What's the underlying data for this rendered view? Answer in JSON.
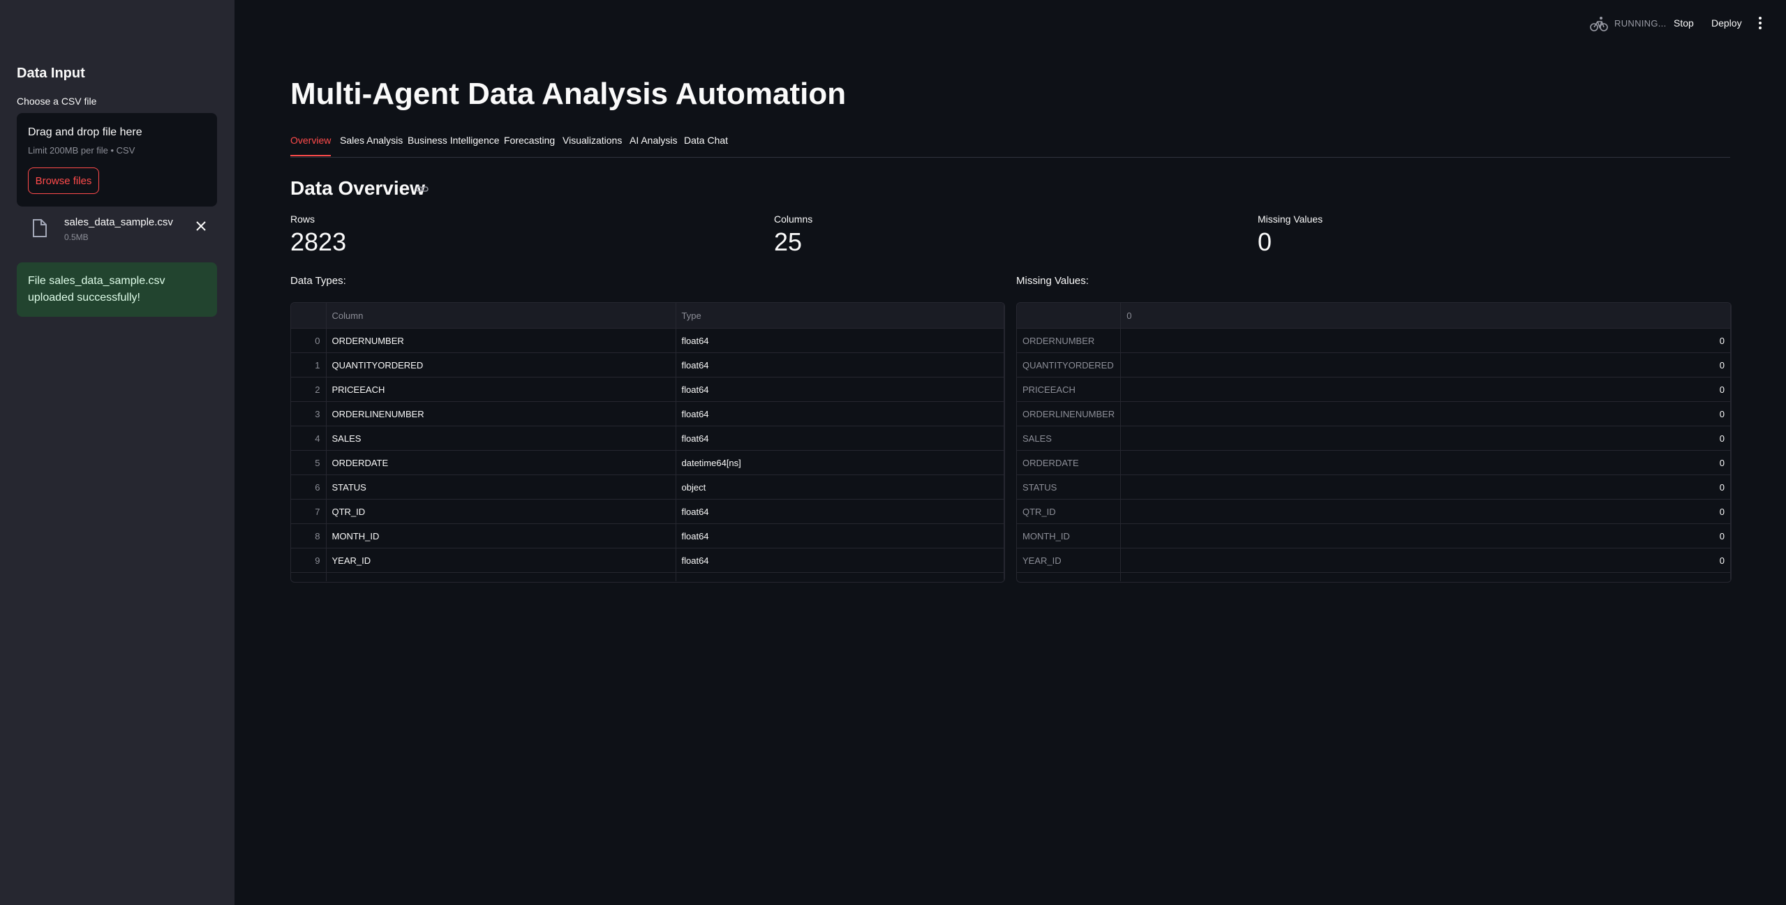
{
  "sidebar": {
    "title": "Data Input",
    "uploader_label": "Choose a CSV file",
    "dropzone_title": "Drag and drop file here",
    "dropzone_limit": "Limit 200MB per file • CSV",
    "browse_label": "Browse files",
    "file": {
      "name": "sales_data_sample.csv",
      "size": "0.5MB"
    },
    "success_message": "File sales_data_sample.csv uploaded successfully!"
  },
  "header": {
    "status": "RUNNING...",
    "stop_label": "Stop",
    "deploy_label": "Deploy"
  },
  "main": {
    "title": "Multi-Agent Data Analysis Automation",
    "tabs": [
      {
        "label": "Overview",
        "active": true
      },
      {
        "label": "Sales Analysis"
      },
      {
        "label": "Business Intelligence"
      },
      {
        "label": "Forecasting"
      },
      {
        "label": "Visualizations"
      },
      {
        "label": "AI Analysis"
      },
      {
        "label": "Data Chat"
      }
    ],
    "section_title": "Data Overview",
    "metrics": {
      "rows": {
        "label": "Rows",
        "value": "2823"
      },
      "columns": {
        "label": "Columns",
        "value": "25"
      },
      "missing": {
        "label": "Missing Values",
        "value": "0"
      }
    },
    "data_types_label": "Data Types:",
    "missing_values_label": "Missing Values:",
    "dtypes_table": {
      "headers": [
        "",
        "Column",
        "Type"
      ],
      "rows": [
        [
          "0",
          "ORDERNUMBER",
          "float64"
        ],
        [
          "1",
          "QUANTITYORDERED",
          "float64"
        ],
        [
          "2",
          "PRICEEACH",
          "float64"
        ],
        [
          "3",
          "ORDERLINENUMBER",
          "float64"
        ],
        [
          "4",
          "SALES",
          "float64"
        ],
        [
          "5",
          "ORDERDATE",
          "datetime64[ns]"
        ],
        [
          "6",
          "STATUS",
          "object"
        ],
        [
          "7",
          "QTR_ID",
          "float64"
        ],
        [
          "8",
          "MONTH_ID",
          "float64"
        ],
        [
          "9",
          "YEAR_ID",
          "float64"
        ]
      ]
    },
    "missing_table": {
      "headers": [
        "",
        "0"
      ],
      "rows": [
        [
          "ORDERNUMBER",
          "0"
        ],
        [
          "QUANTITYORDERED",
          "0"
        ],
        [
          "PRICEEACH",
          "0"
        ],
        [
          "ORDERLINENUMBER",
          "0"
        ],
        [
          "SALES",
          "0"
        ],
        [
          "ORDERDATE",
          "0"
        ],
        [
          "STATUS",
          "0"
        ],
        [
          "QTR_ID",
          "0"
        ],
        [
          "MONTH_ID",
          "0"
        ],
        [
          "YEAR_ID",
          "0"
        ]
      ]
    }
  },
  "colors": {
    "background": "#0e1117",
    "sidebar": "#262730",
    "accent": "#ff4b4b",
    "success_bg": "#22442f"
  }
}
